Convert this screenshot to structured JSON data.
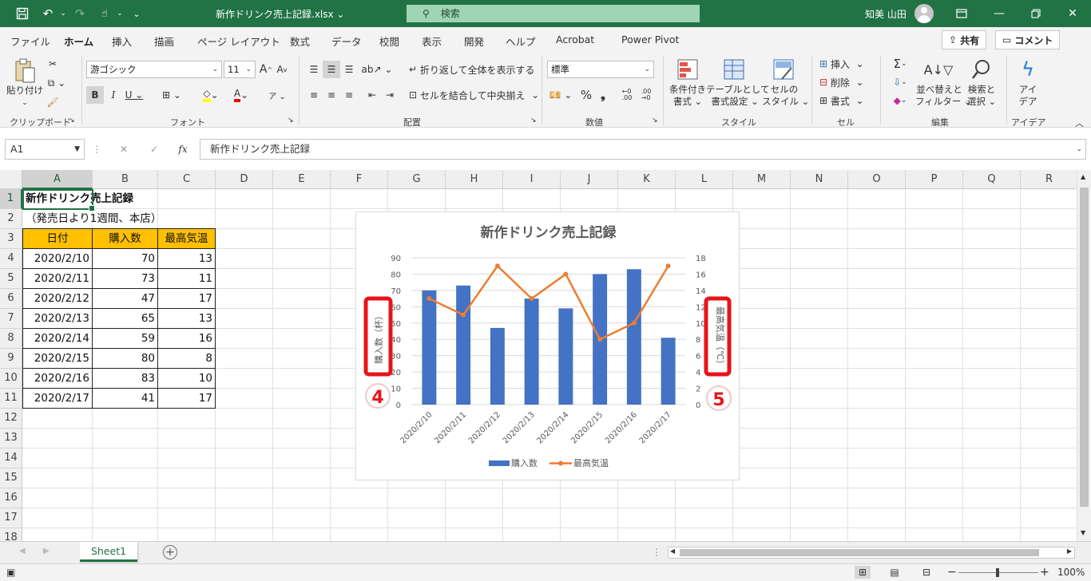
{
  "titlebar": {
    "filename": "新作ドリンク売上記録.xlsx",
    "search_placeholder": "検索",
    "user": "知美 山田"
  },
  "menu": {
    "tabs": [
      "ファイル",
      "ホーム",
      "挿入",
      "描画",
      "ページ レイアウト",
      "数式",
      "データ",
      "校閲",
      "表示",
      "開発",
      "ヘルプ",
      "Acrobat",
      "Power Pivot"
    ],
    "active": "ホーム",
    "share": "共有",
    "comment": "コメント"
  },
  "ribbon": {
    "paste": [
      "貼り付け"
    ],
    "font_name": "游ゴシック",
    "font_size": "11",
    "wrap_text": "折り返して全体を表示する",
    "merge_center": "セルを結合して中央揃え",
    "number_format": "標準",
    "cond_format": [
      "条件付き",
      "書式"
    ],
    "table_format": [
      "テーブルとして",
      "書式設定"
    ],
    "cell_style": [
      "セルの",
      "スタイル"
    ],
    "insert": "挿入",
    "delete": "削除",
    "format": "書式",
    "sort_filter": [
      "並べ替えと",
      "フィルター"
    ],
    "find_select": [
      "検索と",
      "選択"
    ],
    "ideas": [
      "アイ",
      "デア"
    ],
    "groups": [
      "クリップボード",
      "フォント",
      "配置",
      "数値",
      "スタイル",
      "セル",
      "編集",
      "アイデア"
    ]
  },
  "formulabar": {
    "namebox": "A1",
    "content": "新作ドリンク売上記録"
  },
  "sheet": {
    "columns": [
      "A",
      "B",
      "C",
      "D",
      "E",
      "F",
      "G",
      "H",
      "I",
      "J",
      "K",
      "L",
      "M",
      "N",
      "O",
      "P",
      "Q",
      "R"
    ],
    "rows": [
      "1",
      "2",
      "3",
      "4",
      "5",
      "6",
      "7",
      "8",
      "9",
      "10",
      "11",
      "12",
      "13",
      "14",
      "15",
      "16",
      "17",
      "18"
    ],
    "title": "新作ドリンク売上記録",
    "subtitle": "（発売日より1週間、本店）",
    "headers": [
      "日付",
      "購入数",
      "最高気温"
    ],
    "data": [
      [
        "2020/2/10",
        "70",
        "13"
      ],
      [
        "2020/2/11",
        "73",
        "11"
      ],
      [
        "2020/2/12",
        "47",
        "17"
      ],
      [
        "2020/2/13",
        "65",
        "13"
      ],
      [
        "2020/2/14",
        "59",
        "16"
      ],
      [
        "2020/2/15",
        "80",
        "8"
      ],
      [
        "2020/2/16",
        "83",
        "10"
      ],
      [
        "2020/2/17",
        "41",
        "17"
      ]
    ],
    "tab_name": "Sheet1"
  },
  "chart_data": {
    "type": "bar",
    "title": "新作ドリンク売上記録",
    "categories": [
      "2020/2/10",
      "2020/2/11",
      "2020/2/12",
      "2020/2/13",
      "2020/2/14",
      "2020/2/15",
      "2020/2/16",
      "2020/2/17"
    ],
    "series": [
      {
        "name": "購入数",
        "type": "bar",
        "axis": "left",
        "color": "#4472c4",
        "values": [
          70,
          73,
          47,
          65,
          59,
          80,
          83,
          41
        ]
      },
      {
        "name": "最高気温",
        "type": "line",
        "axis": "right",
        "color": "#ed7d31",
        "values": [
          13,
          11,
          17,
          13,
          16,
          8,
          10,
          17
        ]
      }
    ],
    "ylabel": "購入数（杯）",
    "y2label": "最高気温（℃）",
    "ylim": [
      0,
      90
    ],
    "y2lim": [
      0,
      18
    ],
    "yticks": [
      "0",
      "10",
      "20",
      "30",
      "40",
      "50",
      "60",
      "70",
      "80",
      "90"
    ],
    "y2ticks": [
      "0",
      "2",
      "4",
      "6",
      "8",
      "10",
      "12",
      "14",
      "16",
      "18"
    ],
    "legend": "bottom",
    "annotations": [
      {
        "label": "4",
        "color": "#e8141a"
      },
      {
        "label": "5",
        "color": "#e8141a"
      }
    ]
  },
  "statusbar": {
    "zoom": "100%"
  }
}
